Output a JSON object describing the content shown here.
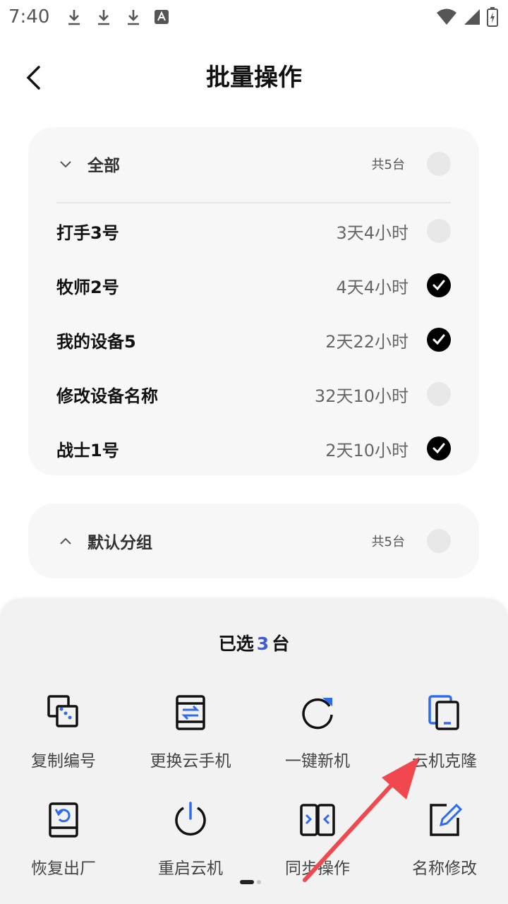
{
  "status_bar": {
    "time": "7:40",
    "left_icons": [
      "download-icon",
      "download-icon",
      "download-icon",
      "font-a-icon"
    ],
    "right_icons": [
      "wifi-icon",
      "signal-icon",
      "battery-charging-icon"
    ]
  },
  "header": {
    "title": "批量操作",
    "back_icon": "chevron-left-icon"
  },
  "groups": [
    {
      "name": "全部",
      "count": "共5台",
      "expanded": true,
      "selected": false,
      "devices": [
        {
          "name": "打手3号",
          "time": "3天4小时",
          "selected": false
        },
        {
          "name": "牧师2号",
          "time": "4天4小时",
          "selected": true
        },
        {
          "name": "我的设备5",
          "time": "2天22小时",
          "selected": true
        },
        {
          "name": "修改设备名称",
          "time": "32天10小时",
          "selected": false
        },
        {
          "name": "战士1号",
          "time": "2天10小时",
          "selected": true
        }
      ]
    },
    {
      "name": "默认分组",
      "count": "共5台",
      "expanded": false,
      "selected": false
    }
  ],
  "bottom_sheet": {
    "selected_prefix": "已选",
    "selected_count": "3",
    "selected_suffix": "台",
    "actions": [
      {
        "label": "复制编号",
        "icon": "copy-number-icon"
      },
      {
        "label": "更换云手机",
        "icon": "swap-phone-icon"
      },
      {
        "label": "一键新机",
        "icon": "refresh-icon"
      },
      {
        "label": "云机克隆",
        "icon": "clone-icon"
      },
      {
        "label": "恢复出厂",
        "icon": "factory-reset-icon"
      },
      {
        "label": "重启云机",
        "icon": "power-icon"
      },
      {
        "label": "同步操作",
        "icon": "sync-operation-icon"
      },
      {
        "label": "名称修改",
        "icon": "edit-name-icon"
      }
    ],
    "page_count": 2,
    "current_page": 1
  },
  "colors": {
    "accent": "#3f5bd9",
    "icon_blue": "#2f6bef",
    "annotation_arrow": "#f0484e",
    "card_bg": "#f7f7f7",
    "sheet_bg": "#f2f2f2"
  }
}
